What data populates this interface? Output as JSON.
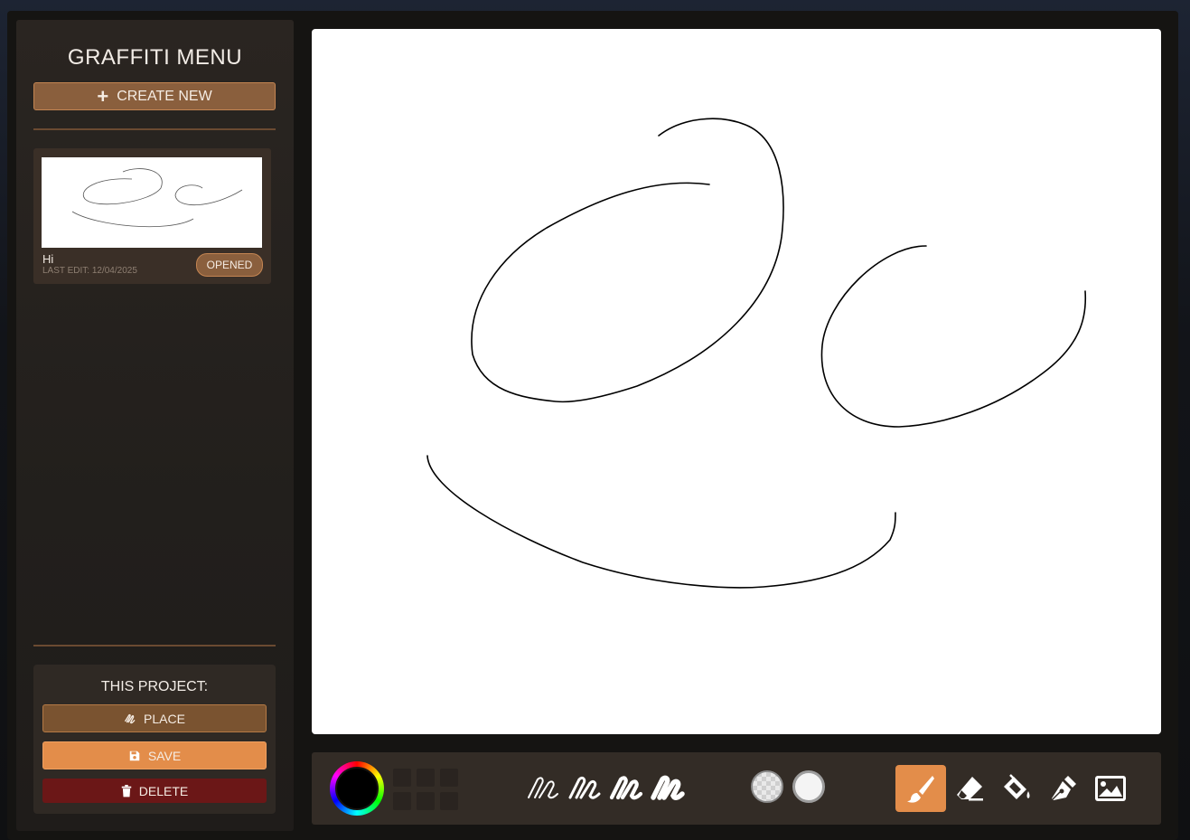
{
  "sidebar": {
    "title": "GRAFFITI MENU",
    "create_new_label": "CREATE NEW",
    "projects": [
      {
        "name": "Hi",
        "last_edit": "LAST EDIT: 12/04/2025",
        "status": "OPENED"
      }
    ]
  },
  "this_project": {
    "title": "THIS PROJECT:",
    "place_label": "PLACE",
    "save_label": "SAVE",
    "delete_label": "DELETE"
  },
  "toolbar": {
    "current_color": "#000000",
    "brush_sizes": [
      "thin",
      "medium",
      "thick",
      "extra-thick"
    ],
    "opacity_options": [
      "transparent",
      "solid"
    ],
    "tools": [
      "brush-icon",
      "eraser-icon",
      "fill-bucket-icon",
      "pen-icon",
      "image-icon"
    ],
    "active_tool": "brush-icon"
  },
  "colors": {
    "accent": "#e38d4a",
    "button_brown": "#8a5f3d",
    "delete_red": "#6b1717",
    "panel": "#2a2521"
  }
}
